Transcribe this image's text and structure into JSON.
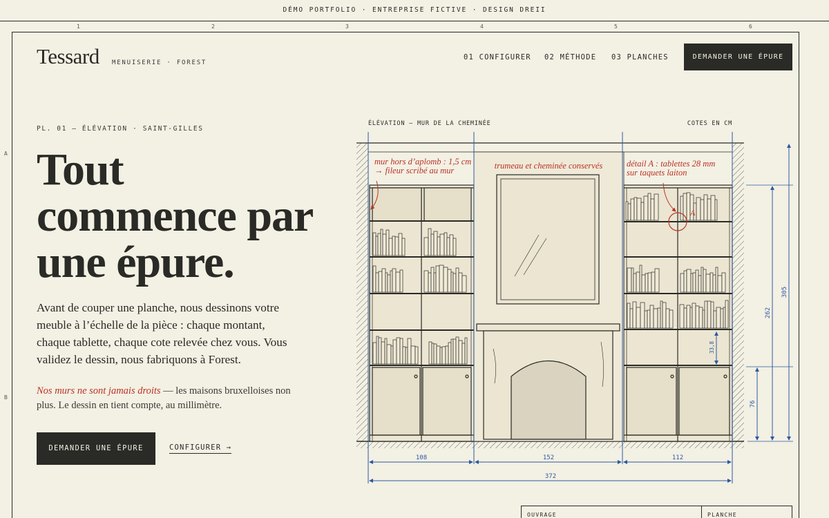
{
  "topbar": {
    "text": "DÉMO PORTFOLIO · ENTREPRISE FICTIVE · DESIGN DREII"
  },
  "grid": {
    "columns": [
      "1",
      "2",
      "3",
      "4",
      "5",
      "6"
    ],
    "rows": [
      "A",
      "B"
    ]
  },
  "brand": {
    "logo": "Tessard",
    "tagline": "MENUISERIE · FOREST"
  },
  "nav": {
    "items": [
      {
        "label": "01 CONFIGURER"
      },
      {
        "label": "02 MÉTHODE"
      },
      {
        "label": "03 PLANCHES"
      }
    ],
    "cta": "DEMANDER UNE ÉPURE"
  },
  "hero": {
    "eyebrow": "PL. 01 — ÉLÉVATION · SAINT-GILLES",
    "headline_lines": [
      "Tout",
      "commence par",
      "une épure."
    ],
    "lead": "Avant de couper une planche, nous dessinons votre meuble à l’échelle de la pièce : chaque montant, chaque tablette, chaque cote relevée chez vous. Vous validez le dessin, nous fabriquons à Forest.",
    "note_em": "Nos murs ne sont jamais droits",
    "note_rest": " — les maisons bruxelloises non plus. Le dessin en tient compte, au millimètre.",
    "cta_primary": "DEMANDER UNE ÉPURE",
    "cta_secondary": "CONFIGURER →"
  },
  "drawing": {
    "title": "ÉLÉVATION — MUR DE LA CHEMINÉE",
    "units": "COTES EN CM",
    "annotations": {
      "left_1": "mur hors d’aplomb : 1,5 cm",
      "left_2": "→ fileur scribé au mur",
      "center": "trumeau et cheminée conservés",
      "right_1": "détail A : tablettes 28 mm",
      "right_2": "sur taquets laiton",
      "detail_mark": "A"
    },
    "dimensions": {
      "left_width": "108",
      "center_width": "152",
      "right_width": "112",
      "total_width": "372",
      "total_height": "305",
      "upper_height": "262",
      "base_height": "76",
      "shelf_spacing": "33,8"
    },
    "colors": {
      "ink": "#2a2a26",
      "red": "#b93324",
      "blue": "#2c5aa0",
      "wood": "#e8e2cf",
      "paper": "#f3f0e4"
    }
  },
  "sheet": {
    "label_left": "OUVRAGE",
    "label_right": "PLANCHE"
  }
}
